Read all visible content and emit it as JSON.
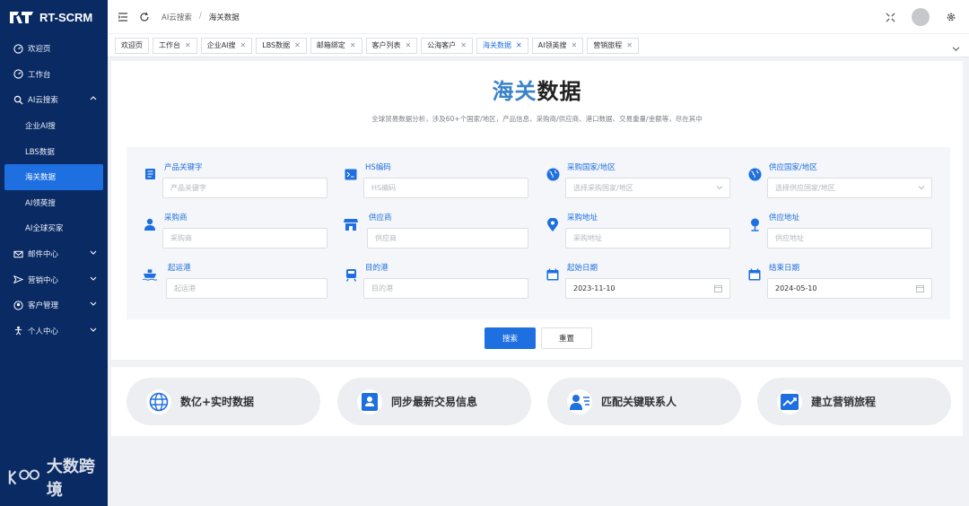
{
  "app": {
    "logo_mark": "RT",
    "logo_text": "RT-SCRM"
  },
  "sidebar": {
    "items": [
      {
        "label": "欢迎页",
        "icon": "dashboard-icon"
      },
      {
        "label": "工作台",
        "icon": "dashboard-icon"
      },
      {
        "label": "AI云搜索",
        "icon": "search-icon",
        "expanded": true
      },
      {
        "label": "企业AI搜",
        "sub": true
      },
      {
        "label": "LBS数据",
        "sub": true
      },
      {
        "label": "海关数据",
        "sub": true,
        "active": true
      },
      {
        "label": "AI领英搜",
        "sub": true
      },
      {
        "label": "AI全球买家",
        "sub": true
      },
      {
        "label": "邮件中心",
        "icon": "mail-icon"
      },
      {
        "label": "营销中心",
        "icon": "send-icon"
      },
      {
        "label": "客户管理",
        "icon": "customer-icon"
      },
      {
        "label": "个人中心",
        "icon": "person-icon"
      }
    ]
  },
  "topbar": {
    "breadcrumb": [
      "AI云搜索",
      "/",
      "海关数据"
    ]
  },
  "tabs": [
    {
      "label": "欢迎页",
      "closable": false
    },
    {
      "label": "工作台",
      "closable": true
    },
    {
      "label": "企业AI搜",
      "closable": true
    },
    {
      "label": "LBS数据",
      "closable": true
    },
    {
      "label": "邮箱绑定",
      "closable": true
    },
    {
      "label": "客户列表",
      "closable": true
    },
    {
      "label": "公海客户",
      "closable": true
    },
    {
      "label": "海关数据",
      "closable": true,
      "active": true
    },
    {
      "label": "AI领英搜",
      "closable": true
    },
    {
      "label": "营销旅程",
      "closable": true
    }
  ],
  "main": {
    "title_accent": "海关",
    "title_rest": "数据",
    "subtitle": "全球贸易数据分析，涉及60+个国家/地区，产品信息、采购商/供应商、港口数据、交易重量/金额等，尽在其中",
    "fields": [
      {
        "label": "产品关键字",
        "placeholder": "产品关键字",
        "icon": "document-icon"
      },
      {
        "label": "HS编码",
        "placeholder": "HS编码",
        "icon": "terminal-icon"
      },
      {
        "label": "采购国家/地区",
        "placeholder": "选择采购国家/地区",
        "icon": "globe-icon",
        "select": true
      },
      {
        "label": "供应国家/地区",
        "placeholder": "选择供应国家/地区",
        "icon": "globe-icon",
        "select": true
      },
      {
        "label": "采购商",
        "placeholder": "采购商",
        "icon": "person-icon"
      },
      {
        "label": "供应商",
        "placeholder": "供应商",
        "icon": "store-icon"
      },
      {
        "label": "采购地址",
        "placeholder": "采购地址",
        "icon": "location-pin-icon"
      },
      {
        "label": "供应地址",
        "placeholder": "供应地址",
        "icon": "map-pin-icon"
      },
      {
        "label": "起运港",
        "placeholder": "起运港",
        "icon": "ship-icon"
      },
      {
        "label": "目的港",
        "placeholder": "目的港",
        "icon": "train-icon"
      },
      {
        "label": "起始日期",
        "value": "2023-11-10",
        "icon": "calendar-icon",
        "date": true
      },
      {
        "label": "结束日期",
        "value": "2024-05-10",
        "icon": "calendar-icon",
        "date": true
      }
    ],
    "search_label": "搜索",
    "reset_label": "重置"
  },
  "features": [
    {
      "label": "数亿+实时数据",
      "icon": "globe-icon"
    },
    {
      "label": "同步最新交易信息",
      "icon": "contact-card-icon"
    },
    {
      "label": "匹配关键联系人",
      "icon": "contacts-icon"
    },
    {
      "label": "建立营销旅程",
      "icon": "trend-chart-icon"
    }
  ],
  "watermark": {
    "text": "大数跨境"
  },
  "colors": {
    "sidebar": "#0a2a64",
    "primary": "#1e6fe0",
    "accent_title": "#3a82c9"
  }
}
